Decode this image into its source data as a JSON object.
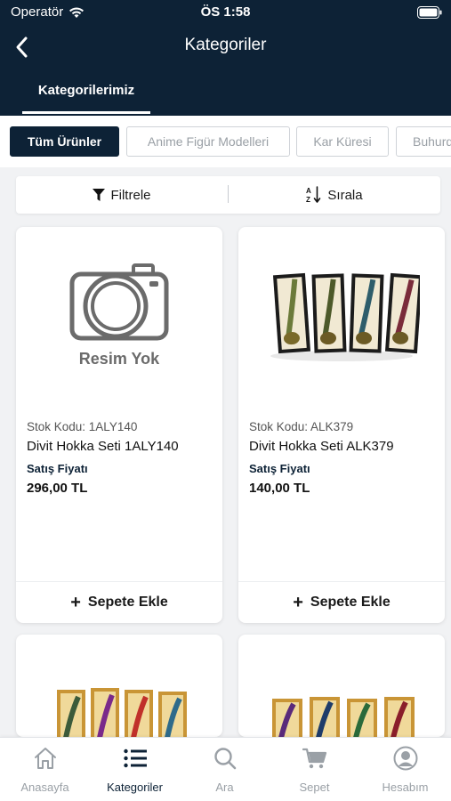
{
  "status_bar": {
    "carrier": "Operatör",
    "time": "ÖS 1:58"
  },
  "nav": {
    "title": "Kategoriler",
    "back_icon": "chevron-left-icon"
  },
  "tabs": [
    {
      "label": "Kategorilerimiz",
      "active": true
    }
  ],
  "chips": [
    {
      "label": "Tüm Ürünler",
      "active": true
    },
    {
      "label": "Anime Figür Modelleri",
      "active": false
    },
    {
      "label": "Kar Küresi",
      "active": false
    },
    {
      "label": "Buhurdanlık",
      "active": false
    }
  ],
  "toolbar": {
    "filter_label": "Filtrele",
    "sort_label": "Sırala",
    "filter_icon": "funnel-icon",
    "sort_icon": "sort-az-icon"
  },
  "products": [
    {
      "stock_code": "Stok Kodu: 1ALY140",
      "name": "Divit Hokka Seti 1ALY140",
      "price_label": "Satış Fiyatı",
      "price": "296,00 TL",
      "image": "no-image-placeholder",
      "no_image_text": "Resim Yok",
      "add_label": "Sepete Ekle"
    },
    {
      "stock_code": "Stok Kodu: ALK379",
      "name": "Divit Hokka Seti ALK379",
      "price_label": "Satış Fiyatı",
      "price": "140,00 TL",
      "image": "quill-pen-set-photo",
      "add_label": "Sepete Ekle"
    },
    {
      "image": "quill-pen-set-photo"
    },
    {
      "image": "quill-pen-set-photo"
    }
  ],
  "tabbar": [
    {
      "label": "Anasayfa",
      "icon": "home-icon",
      "active": false
    },
    {
      "label": "Kategoriler",
      "icon": "list-icon",
      "active": true
    },
    {
      "label": "Ara",
      "icon": "search-icon",
      "active": false
    },
    {
      "label": "Sepet",
      "icon": "cart-icon",
      "active": false
    },
    {
      "label": "Hesabım",
      "icon": "account-icon",
      "active": false
    }
  ],
  "colors": {
    "primary": "#0d2236",
    "inactive": "#9aa0a6",
    "background": "#f1f2f4"
  }
}
